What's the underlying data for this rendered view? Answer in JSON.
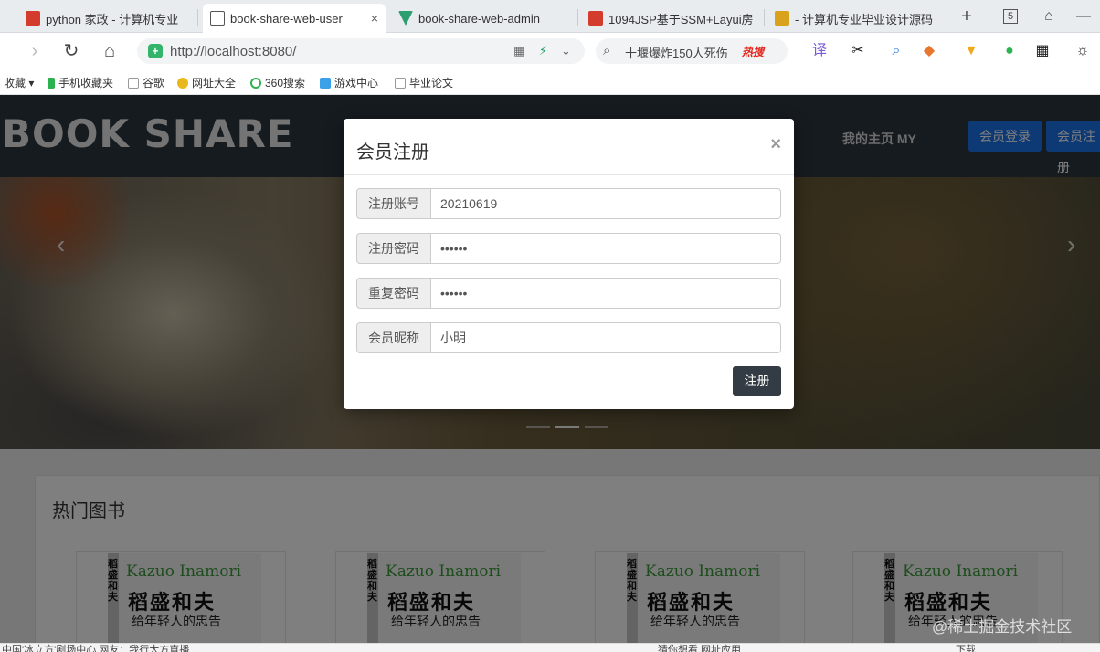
{
  "browser": {
    "tabs": [
      {
        "title": "python 家政 - 计算机专业",
        "favicon_color": "#d33b2c",
        "active": false
      },
      {
        "title": "book-share-web-user",
        "favicon_color": "#555555",
        "active": true
      },
      {
        "title": "book-share-web-admin",
        "favicon_color": "#2b9f70",
        "active": false
      },
      {
        "title": "1094JSP基于SSM+Layui房",
        "favicon_color": "#d33b2c",
        "active": false
      },
      {
        "title": "- 计算机专业毕业设计源码",
        "favicon_color": "#d8a21c",
        "active": false
      }
    ],
    "tab_close": "×",
    "new_tab": "+",
    "tab_count": "5",
    "url": "http://localhost:8080/",
    "search_text": "十堰爆炸150人死伤",
    "search_hot": "热搜",
    "bookmarks": [
      "收藏",
      "手机收藏夹",
      "谷歌",
      "网址大全",
      "360搜索",
      "游戏中心",
      "毕业论文"
    ]
  },
  "site": {
    "logo": "BOOK SHARE",
    "nav_my": "我的主页 MY",
    "login_button": "会员登录",
    "register_button": "会员注册",
    "carousel_prev": "‹",
    "carousel_next": "›",
    "section_title": "热门图书",
    "books": [
      {
        "author": "Kazuo Inamori",
        "title": "稻盛和夫",
        "subtitle": "给年轻人的忠告",
        "spine": "稻盛和夫"
      },
      {
        "author": "Kazuo Inamori",
        "title": "稻盛和夫",
        "subtitle": "给年轻人的忠告",
        "spine": "稻盛和夫"
      },
      {
        "author": "Kazuo Inamori",
        "title": "稻盛和夫",
        "subtitle": "给年轻人的忠告",
        "spine": "稻盛和夫"
      },
      {
        "author": "Kazuo Inamori",
        "title": "稻盛和夫",
        "subtitle": "给年轻人的忠告",
        "spine": "稻盛和夫"
      }
    ]
  },
  "modal": {
    "title": "会员注册",
    "close": "×",
    "fields": [
      {
        "label": "注册账号",
        "value": "20210619"
      },
      {
        "label": "注册密码",
        "value": "••••••"
      },
      {
        "label": "重复密码",
        "value": "••••••"
      },
      {
        "label": "会员昵称",
        "value": "小明"
      }
    ],
    "submit": "注册"
  },
  "status": {
    "left": "中国'冰立方'剧场中心 网友：我行大方直播",
    "right": "猜你想看    网址应用",
    "download": "下载"
  },
  "watermark": "@稀土掘金技术社区",
  "colors": {
    "header_bg": "#2d3640",
    "primary_button": "#1a73e8",
    "submit_button": "#333b44"
  }
}
